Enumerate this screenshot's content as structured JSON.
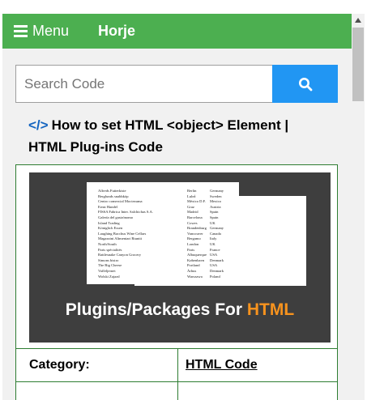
{
  "nav": {
    "menu_label": "Menu",
    "brand": "Horje"
  },
  "search": {
    "placeholder": "Search Code",
    "button_icon": "search-icon"
  },
  "article": {
    "code_icon": "</>",
    "title": "How to set HTML <object> Element | HTML Plug-ins Code"
  },
  "thumbnail": {
    "caption_main": "Plugins/Packages For ",
    "caption_accent": "HTML",
    "rows": [
      [
        "Alfreds Futterkiste",
        "Berlin",
        "Germany"
      ],
      [
        "Berglunds snabbköp",
        "Luleå",
        "Sweden"
      ],
      [
        "Centro comercial Moctezuma",
        "México D.F.",
        "Mexico"
      ],
      [
        "Ernst Handel",
        "Graz",
        "Austria"
      ],
      [
        "FISSA Fabrica Inter. Salchichas S.A.",
        "Madrid",
        "Spain"
      ],
      [
        "Galería del gastrónomo",
        "Barcelona",
        "Spain"
      ],
      [
        "Island Trading",
        "Cowes",
        "UK"
      ],
      [
        "Königlich Essen",
        "Brandenburg",
        "Germany"
      ],
      [
        "Laughing Bacchus Wine Cellars",
        "Vancouver",
        "Canada"
      ],
      [
        "Magazzini Alimentari Riuniti",
        "Bergamo",
        "Italy"
      ],
      [
        "North/South",
        "London",
        "UK"
      ],
      [
        "Paris spécialités",
        "Paris",
        "France"
      ],
      [
        "Rattlesnake Canyon Grocery",
        "Albuquerque",
        "USA"
      ],
      [
        "Simons bistro",
        "København",
        "Denmark"
      ],
      [
        "The Big Cheese",
        "Portland",
        "USA"
      ],
      [
        "Vaffeljernet",
        "Århus",
        "Denmark"
      ],
      [
        "Wolski Zajazd",
        "Warszawa",
        "Poland"
      ]
    ]
  },
  "details": {
    "category_label": "Category:",
    "category_value": "HTML Code"
  },
  "colors": {
    "navbar": "#4caf50",
    "search_button": "#2196f3",
    "table_border": "#2e7d32",
    "caption_accent": "#f7931e"
  }
}
